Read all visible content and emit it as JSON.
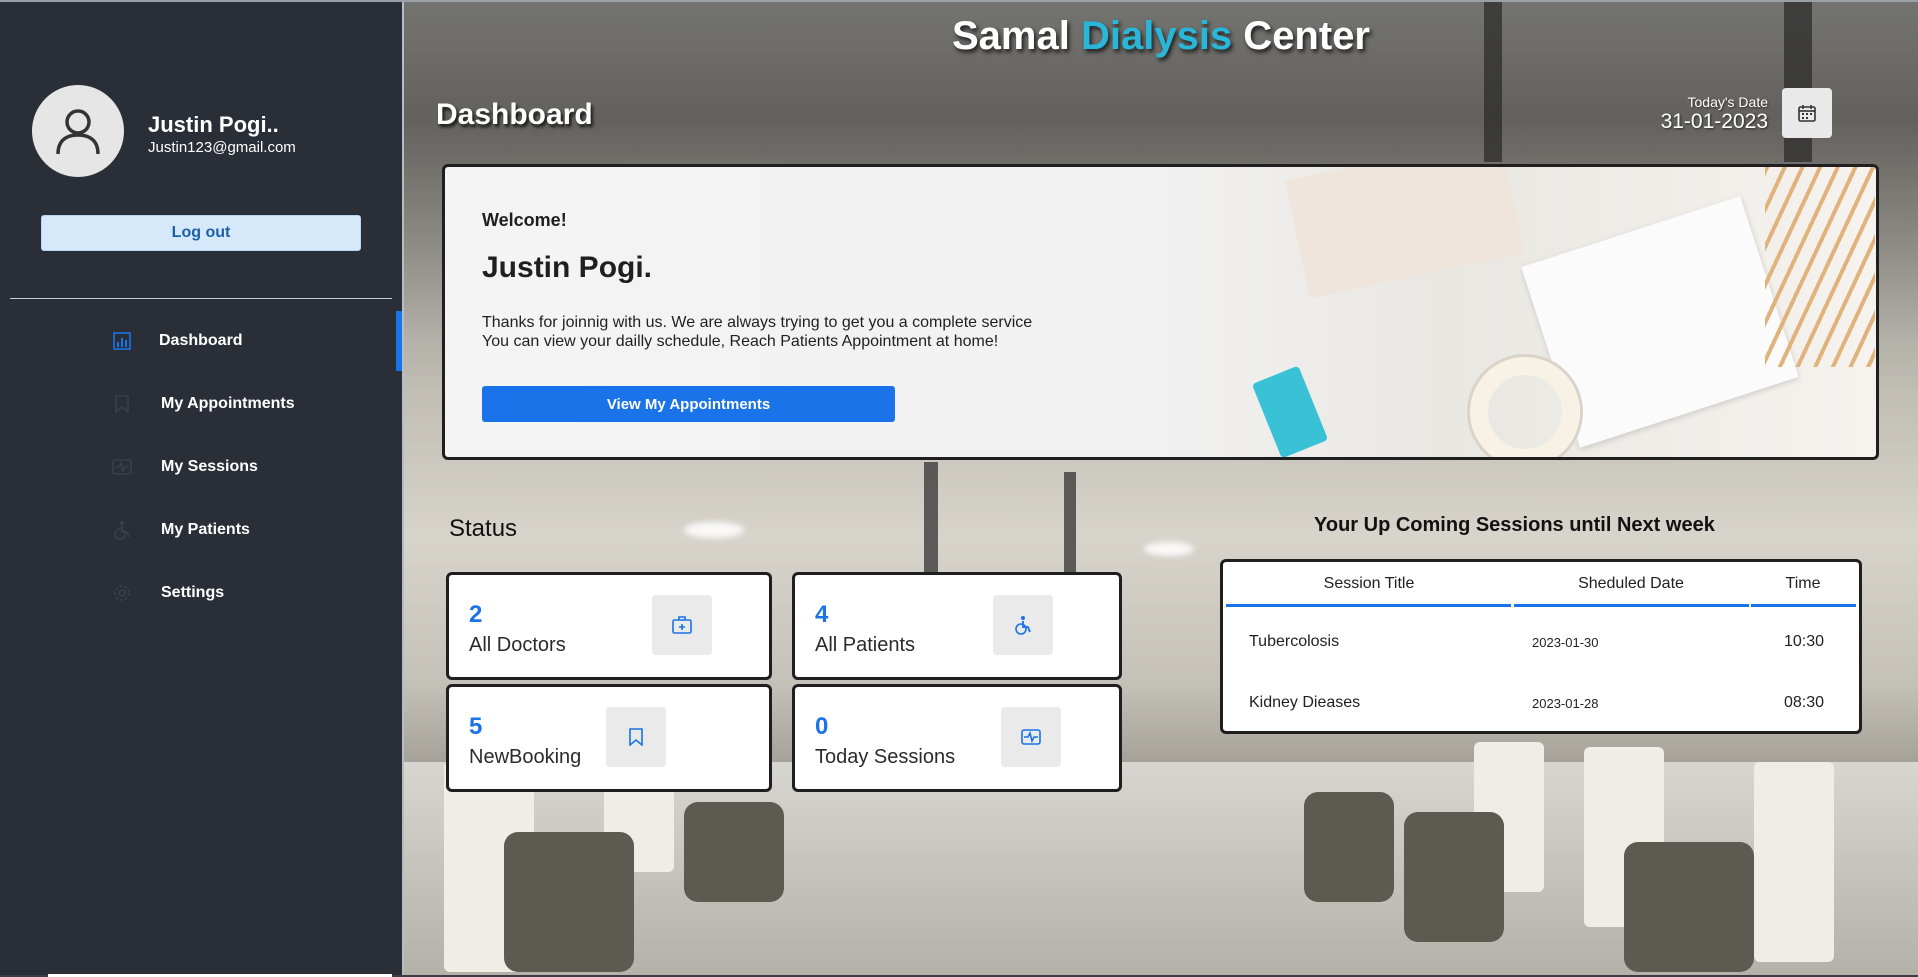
{
  "app": {
    "title_part1": "Samal ",
    "title_accent": "Dialysis",
    "title_part2": " Center",
    "accent_color": "#29b6d8",
    "primary_color": "#1a73e8"
  },
  "user": {
    "name": "Justin Pogi..",
    "email": "Justin123@gmail.com",
    "logout_label": "Log out"
  },
  "sidebar": {
    "items": [
      {
        "label": "Dashboard",
        "icon": "chart-icon",
        "active": true
      },
      {
        "label": "My Appointments",
        "icon": "bookmark-icon",
        "active": false
      },
      {
        "label": "My Sessions",
        "icon": "session-icon",
        "active": false
      },
      {
        "label": "My Patients",
        "icon": "wheelchair-icon",
        "active": false
      },
      {
        "label": "Settings",
        "icon": "gear-icon",
        "active": false
      }
    ]
  },
  "header": {
    "page_title": "Dashboard",
    "date_label": "Today's Date",
    "date_value": "31-01-2023"
  },
  "welcome": {
    "greeting": "Welcome!",
    "name": "Justin Pogi.",
    "line1": "Thanks for joinnig with us. We are always trying to get you a complete service",
    "line2": "You can view your dailly schedule, Reach Patients Appointment at home!",
    "button_label": "View My Appointments"
  },
  "status": {
    "title": "Status",
    "cards": [
      {
        "number": "2",
        "label": "All Doctors",
        "icon": "medical-kit-icon"
      },
      {
        "number": "4",
        "label": "All Patients",
        "icon": "wheelchair-icon"
      },
      {
        "number": "5",
        "label": "NewBooking",
        "icon": "bookmark-icon"
      },
      {
        "number": "0",
        "label": "Today Sessions",
        "icon": "session-icon"
      }
    ]
  },
  "upcoming": {
    "title": "Your Up Coming Sessions until Next week",
    "columns": [
      "Session Title",
      "Sheduled Date",
      "Time"
    ],
    "rows": [
      {
        "title": "Tubercolosis",
        "date": "2023-01-30",
        "time": "10:30"
      },
      {
        "title": "Kidney Dieases",
        "date": "2023-01-28",
        "time": "08:30"
      }
    ]
  }
}
